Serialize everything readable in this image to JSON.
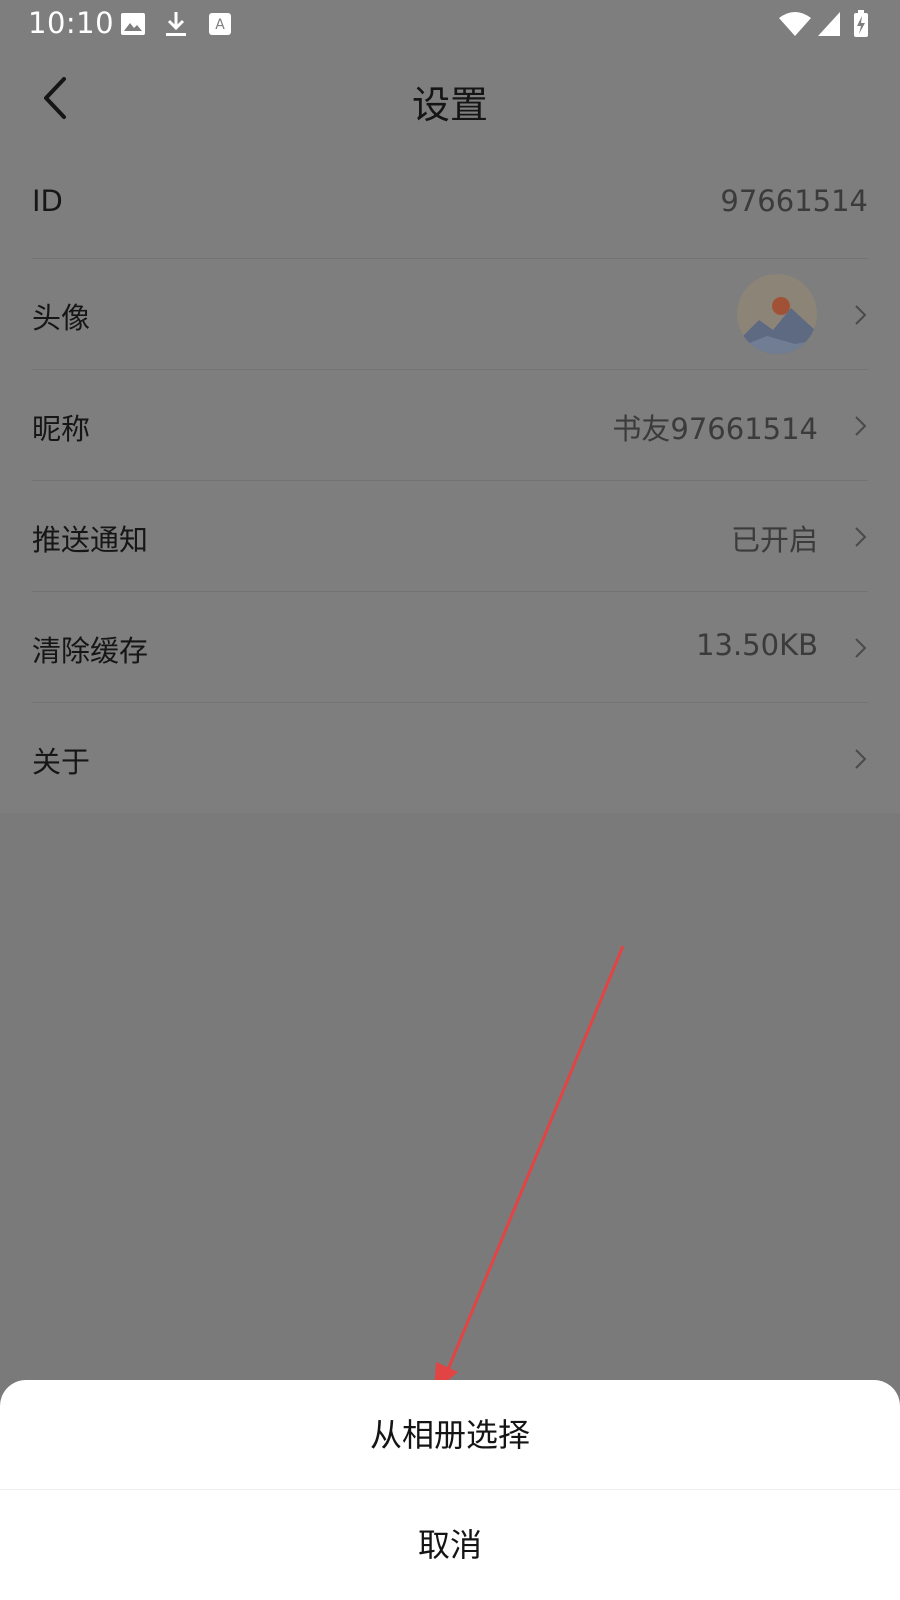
{
  "status_bar": {
    "time": "10:10",
    "icons": [
      "image-icon",
      "download-icon",
      "text-a-icon",
      "wifi-icon",
      "cellular-icon",
      "battery-charging-icon"
    ]
  },
  "header": {
    "title": "设置",
    "back_icon": "chevron-left-icon"
  },
  "settings": {
    "rows": [
      {
        "label": "ID",
        "value": "97661514",
        "has_arrow": false
      },
      {
        "label": "头像",
        "value": "",
        "has_arrow": true,
        "avatar": "mountain-sunset-avatar"
      },
      {
        "label": "昵称",
        "value": "书友97661514",
        "has_arrow": true
      },
      {
        "label": "推送通知",
        "value": "已开启",
        "has_arrow": true
      },
      {
        "label": "清除缓存",
        "value": "13.50KB",
        "has_arrow": true
      },
      {
        "label": "关于",
        "value": "",
        "has_arrow": true
      }
    ]
  },
  "bottom_sheet": {
    "choose_from_album": "从相册选择",
    "cancel": "取消"
  },
  "colors": {
    "overlay_background": "#7a7a7a",
    "annotation_arrow": "#e24444",
    "sheet_background": "#ffffff"
  }
}
